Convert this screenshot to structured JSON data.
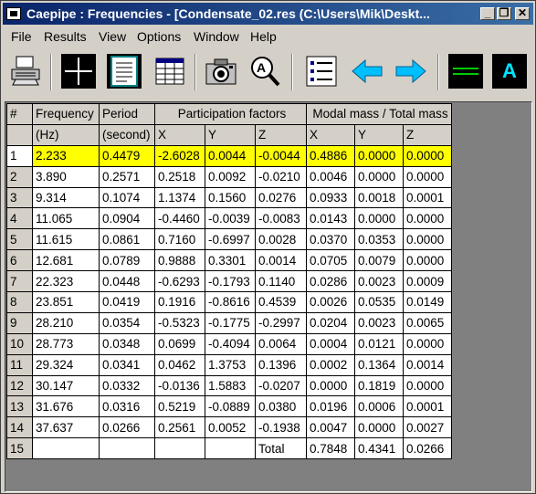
{
  "window": {
    "title": "Caepipe : Frequencies  - [Condensate_02.res (C:\\Users\\Mik\\Deskt...",
    "controls": {
      "minimize": "_",
      "restore": "❐",
      "close": "✕"
    }
  },
  "menu": [
    "File",
    "Results",
    "View",
    "Options",
    "Window",
    "Help"
  ],
  "toolbar": {
    "icons": [
      "printer-icon",
      "grid-icon",
      "document-icon",
      "table-icon",
      "camera-icon",
      "search-icon",
      "list-icon",
      "left-arrow-icon",
      "right-arrow-icon",
      "line-icon",
      "font-icon"
    ],
    "font_label": "A"
  },
  "table": {
    "header_top": {
      "num": "#",
      "freq": "Frequency",
      "period": "Period",
      "participation": "Participation factors",
      "modal": "Modal mass / Total mass"
    },
    "header_sub": {
      "freq_unit": "(Hz)",
      "period_unit": "(second)",
      "px": "X",
      "py": "Y",
      "pz": "Z",
      "mx": "X",
      "my": "Y",
      "mz": "Z"
    },
    "rows": [
      [
        "1",
        "2.233",
        "0.4479",
        "-2.6028",
        "0.0044",
        "-0.0044",
        "0.4886",
        "0.0000",
        "0.0000"
      ],
      [
        "2",
        "3.890",
        "0.2571",
        "0.2518",
        "0.0092",
        "-0.0210",
        "0.0046",
        "0.0000",
        "0.0000"
      ],
      [
        "3",
        "9.314",
        "0.1074",
        "1.1374",
        "0.1560",
        "0.0276",
        "0.0933",
        "0.0018",
        "0.0001"
      ],
      [
        "4",
        "11.065",
        "0.0904",
        "-0.4460",
        "-0.0039",
        "-0.0083",
        "0.0143",
        "0.0000",
        "0.0000"
      ],
      [
        "5",
        "11.615",
        "0.0861",
        "0.7160",
        "-0.6997",
        "0.0028",
        "0.0370",
        "0.0353",
        "0.0000"
      ],
      [
        "6",
        "12.681",
        "0.0789",
        "0.9888",
        "0.3301",
        "0.0014",
        "0.0705",
        "0.0079",
        "0.0000"
      ],
      [
        "7",
        "22.323",
        "0.0448",
        "-0.6293",
        "-0.1793",
        "0.1140",
        "0.0286",
        "0.0023",
        "0.0009"
      ],
      [
        "8",
        "23.851",
        "0.0419",
        "0.1916",
        "-0.8616",
        "0.4539",
        "0.0026",
        "0.0535",
        "0.0149"
      ],
      [
        "9",
        "28.210",
        "0.0354",
        "-0.5323",
        "-0.1775",
        "-0.2997",
        "0.0204",
        "0.0023",
        "0.0065"
      ],
      [
        "10",
        "28.773",
        "0.0348",
        "0.0699",
        "-0.4094",
        "0.0064",
        "0.0004",
        "0.0121",
        "0.0000"
      ],
      [
        "11",
        "29.324",
        "0.0341",
        "0.0462",
        "1.3753",
        "0.1396",
        "0.0002",
        "0.1364",
        "0.0014"
      ],
      [
        "12",
        "30.147",
        "0.0332",
        "-0.0136",
        "1.5883",
        "-0.0207",
        "0.0000",
        "0.1819",
        "0.0000"
      ],
      [
        "13",
        "31.676",
        "0.0316",
        "0.5219",
        "-0.0889",
        "0.0380",
        "0.0196",
        "0.0006",
        "0.0001"
      ],
      [
        "14",
        "37.637",
        "0.0266",
        "0.2561",
        "0.0052",
        "-0.1938",
        "0.0047",
        "0.0000",
        "0.0027"
      ],
      [
        "15",
        "",
        "",
        "",
        "",
        "Total",
        "0.7848",
        "0.4341",
        "0.0266"
      ]
    ],
    "highlight_color": "#ffff00"
  }
}
